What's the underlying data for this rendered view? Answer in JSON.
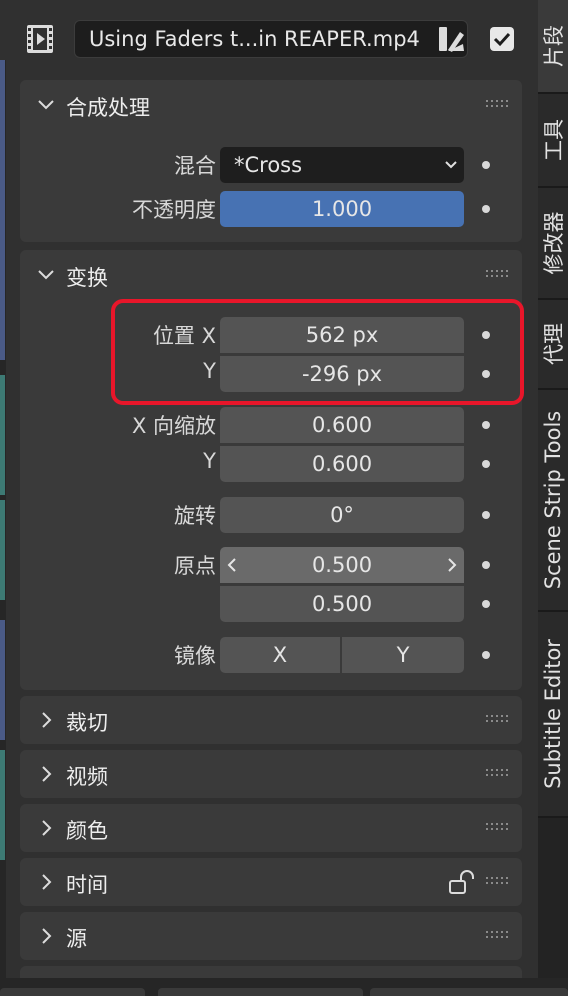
{
  "header": {
    "strip_name": "Using Faders t...in REAPER.mp4",
    "icons": [
      "film-strip-icon",
      "swatch-icon",
      "checkbox-icon"
    ],
    "checkbox_checked": true
  },
  "panels": {
    "compositing": {
      "title": "合成处理",
      "blend_label": "混合",
      "blend_value": "*Cross",
      "opacity_label": "不透明度",
      "opacity_value": "1.000"
    },
    "transform": {
      "title": "变换",
      "position_x_label": "位置 X",
      "position_x_value": "562 px",
      "position_y_label": "Y",
      "position_y_value": "-296 px",
      "scale_x_label": "X 向缩放",
      "scale_x_value": "0.600",
      "scale_y_label": "Y",
      "scale_y_value": "0.600",
      "rotation_label": "旋转",
      "rotation_value": "0°",
      "origin_label": "原点",
      "origin_x_value": "0.500",
      "origin_y_value": "0.500",
      "mirror_label": "镜像",
      "mirror_x": "X",
      "mirror_y": "Y"
    },
    "collapsed": [
      "裁切",
      "视频",
      "颜色",
      "时间",
      "源"
    ]
  },
  "tabs": [
    "片段",
    "工具",
    "修改器",
    "代理",
    "Scene Strip Tools",
    "Subtitle Editor"
  ],
  "colors": {
    "accent_blue": "#4772b3",
    "highlight_red": "#e8162a",
    "panel_bg": "#3a3a3a",
    "field_bg": "#545454"
  }
}
